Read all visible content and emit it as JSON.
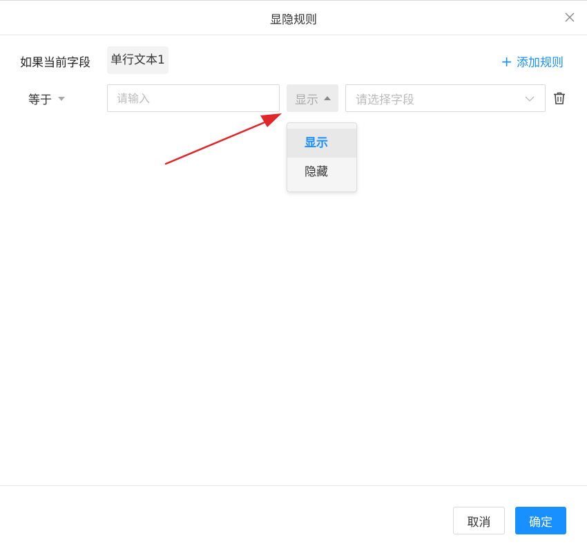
{
  "dialog": {
    "title": "显隐规则",
    "close_icon": "close-icon"
  },
  "condition": {
    "if_label": "如果当前字段",
    "field_name": "单行文本1",
    "add_rule_label": "添加规则",
    "add_rule_icon": "plus-icon"
  },
  "rule": {
    "operator": "等于",
    "value_placeholder": "请输入",
    "action_selected": "显示",
    "target_placeholder": "请选择字段",
    "delete_icon": "trash-icon"
  },
  "dropdown": {
    "options": [
      {
        "label": "显示",
        "selected": true
      },
      {
        "label": "隐藏",
        "selected": false
      }
    ]
  },
  "annotation": {
    "color": "#e0262b"
  },
  "footer": {
    "cancel_label": "取消",
    "confirm_label": "确定"
  },
  "colors": {
    "accent": "#1890ff"
  }
}
